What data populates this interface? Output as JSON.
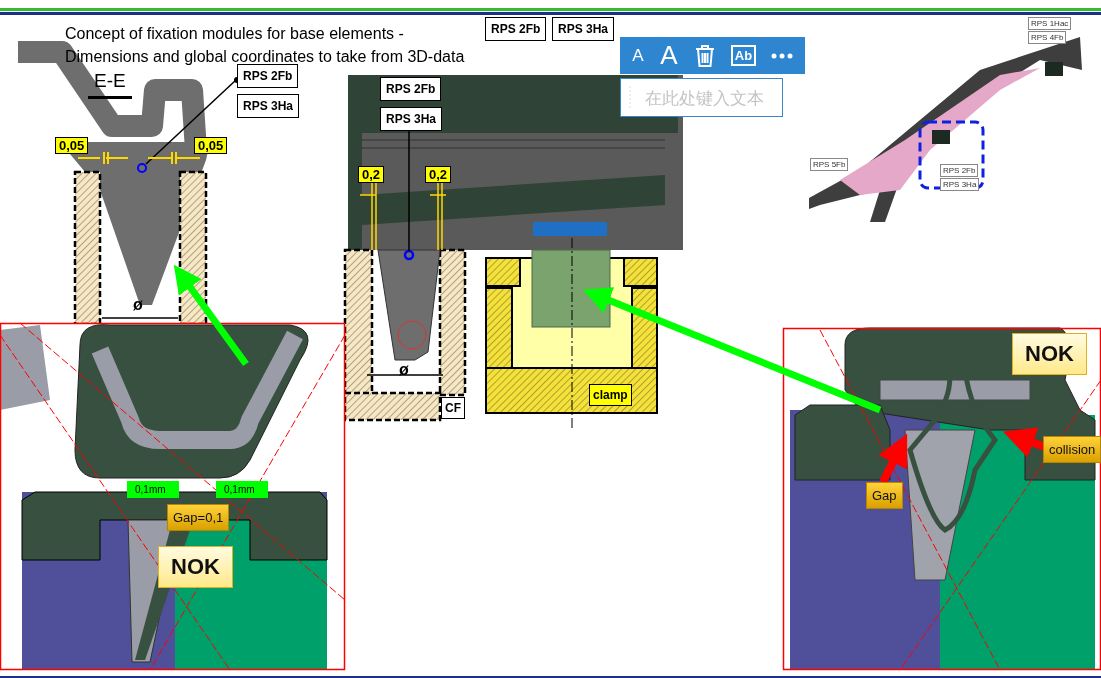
{
  "title_lines": [
    "Concept of fixation modules for base elements -",
    "Dimensions and global coordinates to take from 3D-data"
  ],
  "section_label": "E-E",
  "rps_labels": [
    "RPS 2Fb",
    "RPS 3Ha",
    "RPS 2Fb",
    "RPS 3Ha",
    "RPS 2Fb",
    "RPS 3Ha"
  ],
  "model_labels": [
    "RPS 1Hac",
    "RPS 4Fb",
    "RPS 5Fb",
    "RPS 2Fb",
    "RPS 3Ha"
  ],
  "dimension_labels": [
    "0,05",
    "0,05",
    "0,2",
    "0,2"
  ],
  "diameter_marks": [
    "ø",
    "ø"
  ],
  "part_labels": [
    {
      "text": "CF",
      "kind": "plain"
    },
    {
      "text": "clamp",
      "kind": "highlight"
    }
  ],
  "measure_labels": [
    "0,1mm",
    "0,1mm"
  ],
  "status_labels": [
    {
      "text": "Gap=0,1",
      "kind": "note"
    },
    {
      "text": "NOK",
      "kind": "verdict"
    },
    {
      "text": "NOK",
      "kind": "verdict"
    },
    {
      "text": "Gap",
      "kind": "note"
    },
    {
      "text": "collision",
      "kind": "note"
    }
  ],
  "text_toolbar": {
    "buttons": [
      {
        "kind": "font-smaller",
        "label": "A"
      },
      {
        "kind": "font-larger",
        "label": "A"
      },
      {
        "kind": "delete"
      },
      {
        "kind": "text-style",
        "label": "Ab"
      },
      {
        "kind": "more"
      }
    ]
  },
  "text_input": {
    "placeholder": "在此处键入文本"
  }
}
